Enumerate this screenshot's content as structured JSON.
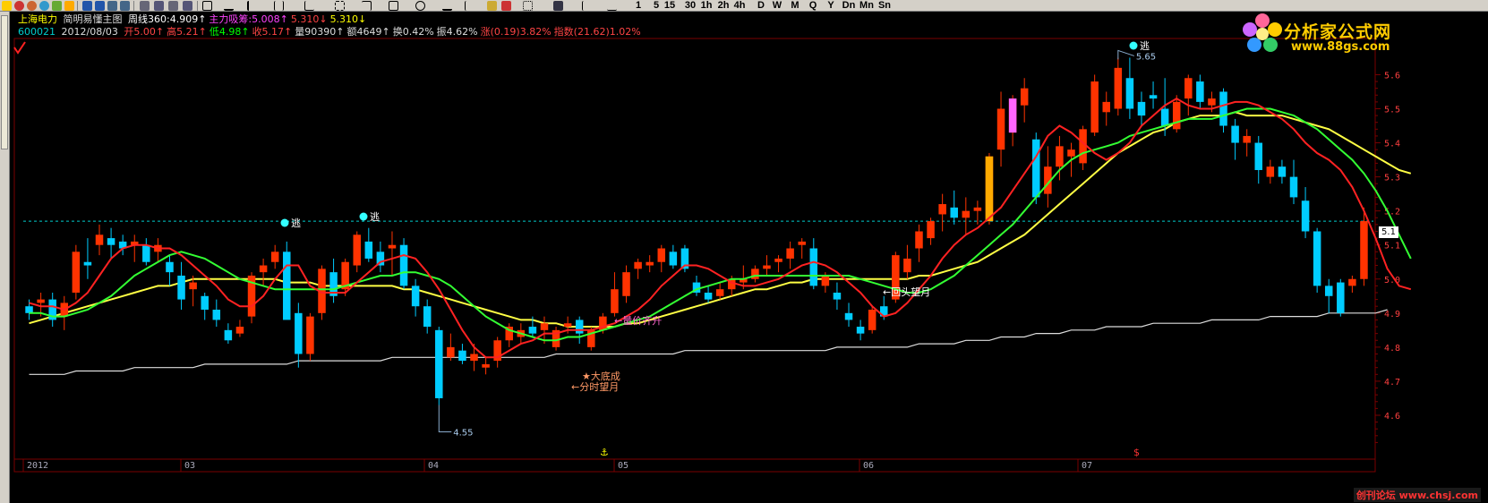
{
  "toolbar": {
    "periods": [
      "1",
      "5",
      "15",
      "30",
      "1h",
      "2h",
      "4h",
      "D",
      "W",
      "M",
      "Q",
      "Y",
      "Dn",
      "Mn",
      "Sn"
    ]
  },
  "header": {
    "stock_name": "上海电力",
    "formula_name": "简明易懂主图",
    "line1": [
      {
        "text": "周线360:4.909↑",
        "color": "#ffffff"
      },
      {
        "text": "主力吸筹:5.008↑",
        "color": "#ff44ff"
      },
      {
        "text": "5.310↓",
        "color": "#ff4444"
      },
      {
        "text": "5.310↓",
        "color": "#ffff00"
      }
    ],
    "code": "600021",
    "date": "2012/08/03",
    "line2": [
      {
        "text": "开5.00↑",
        "color": "#ff4444"
      },
      {
        "text": "高5.21↑",
        "color": "#ff4444"
      },
      {
        "text": "低4.98↑",
        "color": "#00ff00"
      },
      {
        "text": "收5.17↑",
        "color": "#ff4444"
      },
      {
        "text": "量90390↑",
        "color": "#dddddd"
      },
      {
        "text": "额4649↑",
        "color": "#dddddd"
      },
      {
        "text": "换0.42%",
        "color": "#dddddd"
      },
      {
        "text": "振4.62%",
        "color": "#dddddd"
      },
      {
        "text": "涨(0.19)3.82%",
        "color": "#ff4444"
      },
      {
        "text": "指数(21.62)1.02%",
        "color": "#ff4444"
      }
    ]
  },
  "logo": {
    "text": "分析家公式网",
    "url": "www.88gs.com"
  },
  "bottom_credit": "创刊论坛 www.chsj.com",
  "price_tag": "5.1",
  "y_axis_labels": [
    "5.6",
    "5.5",
    "5.4",
    "5.3",
    "5.2",
    "5.1",
    "5.0",
    "4.9",
    "4.8",
    "4.7",
    "4.6"
  ],
  "x_axis_labels": [
    "2012",
    "03",
    "04",
    "05",
    "06",
    "07"
  ],
  "annotations": {
    "escape1": "逃",
    "escape2": "逃",
    "escape3": "逃",
    "high_label": "5.65",
    "low_label": "4.55",
    "volume_price": "←量价齐升",
    "big_bottom": "★大底成",
    "intraday": "←分时望月",
    "look_back": "←回头望月"
  },
  "chart_data": {
    "type": "candlestick",
    "title": "上海电力 600021 周线",
    "ylim": [
      4.55,
      5.68
    ],
    "last_price": 5.17,
    "support_line": 5.17,
    "candles": [
      [
        4.92,
        4.94,
        4.88,
        4.9
      ],
      [
        4.93,
        4.96,
        4.89,
        4.94
      ],
      [
        4.94,
        4.96,
        4.86,
        4.88
      ],
      [
        4.89,
        4.95,
        4.85,
        4.93
      ],
      [
        4.96,
        5.1,
        4.94,
        5.08
      ],
      [
        5.05,
        5.12,
        5.0,
        5.04
      ],
      [
        5.1,
        5.16,
        5.07,
        5.13
      ],
      [
        5.12,
        5.15,
        5.06,
        5.1
      ],
      [
        5.11,
        5.13,
        5.07,
        5.09
      ],
      [
        5.1,
        5.13,
        5.05,
        5.11
      ],
      [
        5.1,
        5.12,
        5.04,
        5.05
      ],
      [
        5.08,
        5.12,
        5.05,
        5.1
      ],
      [
        5.05,
        5.07,
        4.98,
        5.02
      ],
      [
        5.01,
        5.05,
        4.91,
        4.94
      ],
      [
        4.97,
        5.01,
        4.92,
        4.99
      ],
      [
        4.95,
        4.96,
        4.88,
        4.91
      ],
      [
        4.91,
        4.94,
        4.86,
        4.88
      ],
      [
        4.85,
        4.87,
        4.81,
        4.82
      ],
      [
        4.84,
        4.88,
        4.83,
        4.86
      ],
      [
        4.89,
        5.02,
        4.87,
        5.01
      ],
      [
        5.02,
        5.06,
        4.98,
        5.04
      ],
      [
        5.05,
        5.1,
        5.03,
        5.08
      ],
      [
        5.08,
        5.11,
        4.93,
        4.88
      ],
      [
        4.9,
        4.93,
        4.74,
        4.78
      ],
      [
        4.78,
        4.9,
        4.76,
        4.89
      ],
      [
        4.9,
        5.04,
        4.88,
        5.03
      ],
      [
        5.02,
        5.06,
        4.93,
        4.95
      ],
      [
        4.97,
        5.06,
        4.95,
        5.05
      ],
      [
        5.04,
        5.14,
        5.02,
        5.13
      ],
      [
        5.11,
        5.15,
        5.05,
        5.06
      ],
      [
        5.08,
        5.11,
        5.02,
        5.04
      ],
      [
        5.09,
        5.14,
        5.01,
        5.1
      ],
      [
        5.1,
        5.12,
        4.97,
        4.98
      ],
      [
        4.98,
        5.0,
        4.89,
        4.92
      ],
      [
        4.92,
        4.94,
        4.84,
        4.86
      ],
      [
        4.85,
        4.86,
        4.63,
        4.65
      ],
      [
        4.77,
        4.84,
        4.76,
        4.8
      ],
      [
        4.79,
        4.81,
        4.75,
        4.76
      ],
      [
        4.76,
        4.81,
        4.73,
        4.78
      ],
      [
        4.74,
        4.77,
        4.72,
        4.75
      ],
      [
        4.76,
        4.83,
        4.74,
        4.82
      ],
      [
        4.82,
        4.87,
        4.8,
        4.86
      ],
      [
        4.83,
        4.87,
        4.81,
        4.85
      ],
      [
        4.86,
        4.89,
        4.83,
        4.84
      ],
      [
        4.85,
        4.89,
        4.81,
        4.87
      ],
      [
        4.8,
        4.86,
        4.79,
        4.85
      ],
      [
        4.86,
        4.89,
        4.84,
        4.87
      ],
      [
        4.88,
        4.89,
        4.81,
        4.84
      ],
      [
        4.8,
        4.86,
        4.79,
        4.85
      ],
      [
        4.85,
        4.9,
        4.84,
        4.89
      ],
      [
        4.9,
        5.02,
        4.89,
        4.97
      ],
      [
        4.95,
        5.04,
        4.93,
        5.02
      ],
      [
        5.03,
        5.06,
        5.0,
        5.05
      ],
      [
        5.04,
        5.07,
        5.02,
        5.05
      ],
      [
        5.05,
        5.1,
        5.02,
        5.09
      ],
      [
        5.08,
        5.1,
        5.03,
        5.04
      ],
      [
        5.09,
        5.1,
        5.02,
        5.03
      ],
      [
        4.99,
        5.01,
        4.95,
        4.96
      ],
      [
        4.96,
        4.98,
        4.93,
        4.94
      ],
      [
        4.95,
        4.99,
        4.94,
        4.97
      ],
      [
        4.97,
        5.01,
        4.95,
        5.0
      ],
      [
        4.99,
        5.04,
        4.97,
        5.0
      ],
      [
        5.0,
        5.04,
        4.99,
        5.03
      ],
      [
        5.03,
        5.07,
        5.01,
        5.04
      ],
      [
        5.05,
        5.07,
        5.02,
        5.06
      ],
      [
        5.06,
        5.11,
        5.03,
        5.09
      ],
      [
        5.1,
        5.12,
        5.06,
        5.11
      ],
      [
        5.09,
        5.12,
        4.97,
        4.98
      ],
      [
        4.98,
        5.02,
        4.96,
        5.01
      ],
      [
        4.96,
        4.99,
        4.91,
        4.94
      ],
      [
        4.9,
        4.93,
        4.86,
        4.88
      ],
      [
        4.86,
        4.88,
        4.82,
        4.84
      ],
      [
        4.85,
        4.92,
        4.84,
        4.91
      ],
      [
        4.92,
        4.95,
        4.88,
        4.89
      ],
      [
        4.94,
        5.08,
        4.93,
        5.07
      ],
      [
        5.02,
        5.1,
        5.0,
        5.06
      ],
      [
        5.09,
        5.16,
        5.05,
        5.14
      ],
      [
        5.12,
        5.18,
        5.1,
        5.17
      ],
      [
        5.19,
        5.25,
        5.14,
        5.22
      ],
      [
        5.21,
        5.26,
        5.16,
        5.18
      ],
      [
        5.18,
        5.24,
        5.13,
        5.2
      ],
      [
        5.2,
        5.23,
        5.16,
        5.21
      ],
      [
        5.17,
        5.37,
        5.16,
        5.36
      ],
      [
        5.38,
        5.55,
        5.33,
        5.5
      ],
      [
        5.43,
        5.54,
        5.39,
        5.53
      ],
      [
        5.51,
        5.59,
        5.46,
        5.56
      ],
      [
        5.41,
        5.43,
        5.22,
        5.24
      ],
      [
        5.25,
        5.39,
        5.21,
        5.33
      ],
      [
        5.33,
        5.42,
        5.29,
        5.39
      ],
      [
        5.36,
        5.4,
        5.3,
        5.38
      ],
      [
        5.34,
        5.45,
        5.32,
        5.44
      ],
      [
        5.43,
        5.6,
        5.42,
        5.58
      ],
      [
        5.49,
        5.55,
        5.45,
        5.52
      ],
      [
        5.5,
        5.65,
        5.48,
        5.62
      ],
      [
        5.59,
        5.65,
        5.47,
        5.5
      ],
      [
        5.52,
        5.55,
        5.45,
        5.48
      ],
      [
        5.54,
        5.58,
        5.5,
        5.53
      ],
      [
        5.5,
        5.59,
        5.42,
        5.45
      ],
      [
        5.44,
        5.54,
        5.43,
        5.52
      ],
      [
        5.53,
        5.6,
        5.48,
        5.59
      ],
      [
        5.58,
        5.6,
        5.5,
        5.52
      ],
      [
        5.51,
        5.55,
        5.49,
        5.53
      ],
      [
        5.55,
        5.56,
        5.43,
        5.45
      ],
      [
        5.45,
        5.47,
        5.35,
        5.4
      ],
      [
        5.4,
        5.44,
        5.36,
        5.42
      ],
      [
        5.4,
        5.42,
        5.28,
        5.32
      ],
      [
        5.3,
        5.35,
        5.28,
        5.33
      ],
      [
        5.33,
        5.35,
        5.28,
        5.3
      ],
      [
        5.3,
        5.35,
        5.22,
        5.24
      ],
      [
        5.23,
        5.27,
        5.12,
        5.14
      ],
      [
        5.14,
        5.15,
        4.96,
        4.98
      ],
      [
        4.98,
        5.0,
        4.9,
        4.95
      ],
      [
        4.99,
        5.0,
        4.89,
        4.9
      ],
      [
        4.98,
        5.01,
        4.96,
        5.0
      ],
      [
        5.0,
        5.21,
        4.98,
        5.17
      ]
    ],
    "ma5": [
      4.93,
      4.92,
      4.92,
      4.91,
      4.93,
      4.96,
      5.01,
      5.06,
      5.09,
      5.1,
      5.1,
      5.09,
      5.09,
      5.07,
      5.04,
      5.01,
      4.98,
      4.94,
      4.92,
      4.92,
      4.95,
      5.0,
      5.04,
      5.04,
      4.98,
      4.96,
      4.96,
      4.96,
      4.99,
      5.02,
      5.05,
      5.06,
      5.07,
      5.06,
      5.02,
      4.97,
      4.91,
      4.85,
      4.8,
      4.77,
      4.77,
      4.79,
      4.81,
      4.82,
      4.84,
      4.84,
      4.85,
      4.85,
      4.85,
      4.86,
      4.87,
      4.89,
      4.91,
      4.94,
      4.98,
      5.01,
      5.04,
      5.04,
      5.03,
      5.01,
      4.99,
      4.98,
      4.98,
      4.99,
      5.0,
      5.02,
      5.04,
      5.05,
      5.04,
      5.02,
      4.99,
      4.96,
      4.92,
      4.89,
      4.9,
      4.93,
      4.97,
      5.01,
      5.06,
      5.1,
      5.13,
      5.15,
      5.18,
      5.21,
      5.26,
      5.31,
      5.36,
      5.42,
      5.45,
      5.43,
      5.4,
      5.37,
      5.35,
      5.37,
      5.4,
      5.45,
      5.48,
      5.51,
      5.53,
      5.51,
      5.5,
      5.5,
      5.51,
      5.52,
      5.52,
      5.51,
      5.49,
      5.47,
      5.44,
      5.4,
      5.37,
      5.35,
      5.32,
      5.27,
      5.2,
      5.12,
      5.03,
      4.98,
      4.97
    ],
    "ma10": [
      4.9,
      4.9,
      4.89,
      4.89,
      4.9,
      4.91,
      4.93,
      4.95,
      4.98,
      5.01,
      5.03,
      5.05,
      5.07,
      5.08,
      5.07,
      5.06,
      5.04,
      5.02,
      5.0,
      4.99,
      4.98,
      4.97,
      4.97,
      4.97,
      4.97,
      4.97,
      4.97,
      4.98,
      4.99,
      5.0,
      5.01,
      5.01,
      5.02,
      5.02,
      5.01,
      5.0,
      4.98,
      4.95,
      4.92,
      4.89,
      4.87,
      4.85,
      4.84,
      4.83,
      4.82,
      4.82,
      4.83,
      4.83,
      4.84,
      4.85,
      4.86,
      4.87,
      4.88,
      4.89,
      4.91,
      4.93,
      4.95,
      4.97,
      4.98,
      4.99,
      5.0,
      5.0,
      5.01,
      5.01,
      5.01,
      5.01,
      5.01,
      5.01,
      5.01,
      5.01,
      5.01,
      5.0,
      4.99,
      4.98,
      4.97,
      4.96,
      4.96,
      4.97,
      4.99,
      5.01,
      5.04,
      5.07,
      5.1,
      5.13,
      5.16,
      5.2,
      5.24,
      5.28,
      5.32,
      5.35,
      5.37,
      5.38,
      5.39,
      5.4,
      5.42,
      5.43,
      5.44,
      5.45,
      5.46,
      5.47,
      5.47,
      5.47,
      5.48,
      5.49,
      5.5,
      5.5,
      5.5,
      5.49,
      5.48,
      5.46,
      5.44,
      5.41,
      5.38,
      5.35,
      5.31,
      5.26,
      5.2,
      5.13,
      5.06
    ],
    "ma_yellow": [
      4.87,
      4.88,
      4.89,
      4.9,
      4.91,
      4.92,
      4.93,
      4.94,
      4.95,
      4.96,
      4.97,
      4.98,
      4.98,
      4.99,
      5.0,
      5.0,
      5.0,
      5.0,
      5.0,
      5.0,
      5.0,
      5.0,
      4.99,
      4.99,
      4.99,
      4.98,
      4.98,
      4.98,
      4.98,
      4.98,
      4.98,
      4.98,
      4.97,
      4.97,
      4.96,
      4.95,
      4.94,
      4.93,
      4.92,
      4.91,
      4.9,
      4.89,
      4.88,
      4.88,
      4.87,
      4.87,
      4.86,
      4.86,
      4.86,
      4.86,
      4.86,
      4.87,
      4.87,
      4.88,
      4.89,
      4.9,
      4.91,
      4.92,
      4.93,
      4.94,
      4.95,
      4.96,
      4.97,
      4.97,
      4.98,
      4.99,
      4.99,
      5.0,
      5.0,
      5.0,
      5.0,
      5.0,
      5.0,
      5.0,
      5.0,
      5.0,
      5.01,
      5.01,
      5.02,
      5.03,
      5.04,
      5.05,
      5.07,
      5.09,
      5.11,
      5.13,
      5.16,
      5.19,
      5.22,
      5.25,
      5.28,
      5.31,
      5.34,
      5.37,
      5.39,
      5.41,
      5.43,
      5.44,
      5.46,
      5.47,
      5.48,
      5.48,
      5.48,
      5.49,
      5.48,
      5.48,
      5.48,
      5.48,
      5.47,
      5.46,
      5.45,
      5.44,
      5.42,
      5.4,
      5.38,
      5.36,
      5.34,
      5.32,
      5.31
    ],
    "ma_white": [
      4.72,
      4.72,
      4.72,
      4.72,
      4.73,
      4.73,
      4.73,
      4.73,
      4.73,
      4.74,
      4.74,
      4.74,
      4.74,
      4.74,
      4.74,
      4.75,
      4.75,
      4.75,
      4.75,
      4.75,
      4.75,
      4.75,
      4.75,
      4.76,
      4.76,
      4.76,
      4.76,
      4.76,
      4.76,
      4.76,
      4.76,
      4.77,
      4.77,
      4.77,
      4.77,
      4.77,
      4.77,
      4.77,
      4.77,
      4.77,
      4.77,
      4.77,
      4.77,
      4.77,
      4.77,
      4.78,
      4.78,
      4.78,
      4.78,
      4.78,
      4.78,
      4.78,
      4.78,
      4.78,
      4.78,
      4.78,
      4.79,
      4.79,
      4.79,
      4.79,
      4.79,
      4.79,
      4.79,
      4.79,
      4.79,
      4.79,
      4.79,
      4.79,
      4.79,
      4.8,
      4.8,
      4.8,
      4.8,
      4.8,
      4.8,
      4.8,
      4.81,
      4.81,
      4.81,
      4.81,
      4.82,
      4.82,
      4.82,
      4.83,
      4.83,
      4.83,
      4.84,
      4.84,
      4.84,
      4.85,
      4.85,
      4.85,
      4.86,
      4.86,
      4.86,
      4.86,
      4.87,
      4.87,
      4.87,
      4.87,
      4.87,
      4.88,
      4.88,
      4.88,
      4.88,
      4.88,
      4.89,
      4.89,
      4.89,
      4.89,
      4.89,
      4.9,
      4.9,
      4.9,
      4.9,
      4.9,
      4.91
    ]
  }
}
